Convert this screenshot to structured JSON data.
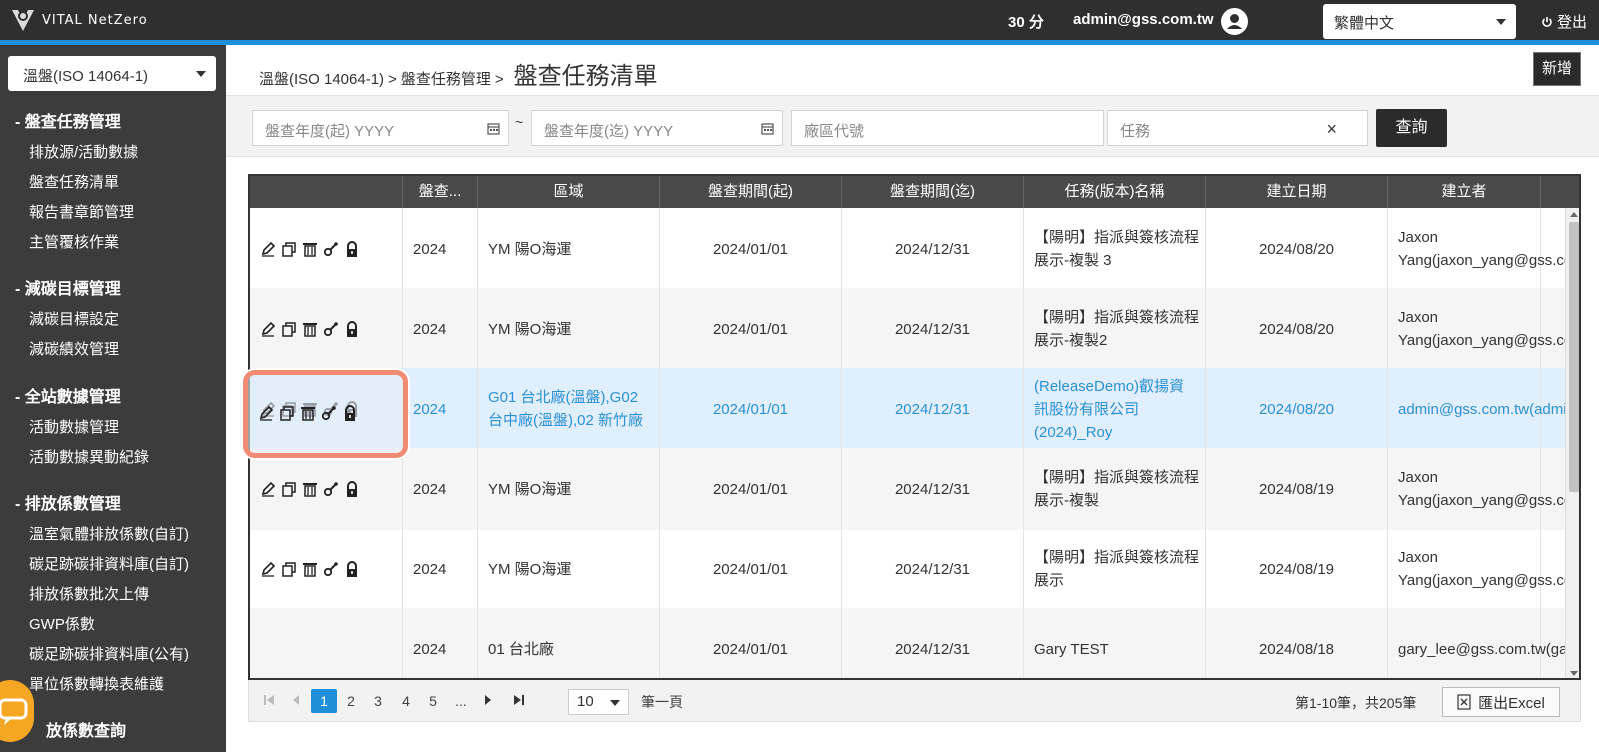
{
  "app": {
    "logo_text": "VITAL NetZero"
  },
  "topbar": {
    "timer": "30 分",
    "user_email": "admin@gss.com.tw",
    "language": "繁體中文",
    "logout_label": "登出"
  },
  "sidebar": {
    "module": "溫盤(ISO 14064-1)",
    "groups": [
      {
        "title": "- 盤查任務管理",
        "items": [
          "排放源/活動數據",
          "盤查任務清單",
          "報告書章節管理",
          "主管覆核作業"
        ]
      },
      {
        "title": "- 減碳目標管理",
        "items": [
          "減碳目標設定",
          "減碳績效管理"
        ]
      },
      {
        "title": "- 全站數據管理",
        "items": [
          "活動數據管理",
          "活動數據異動紀錄"
        ]
      },
      {
        "title": "- 排放係數管理",
        "items": [
          "溫室氣體排放係數(自訂)",
          "碳足跡碳排資料庫(自訂)",
          "排放係數批次上傳",
          "GWP係數",
          "碳足跡碳排資料庫(公有)",
          "單位係數轉換表維護"
        ]
      },
      {
        "title": "放係數查詢",
        "items": []
      }
    ]
  },
  "header": {
    "crumbs": [
      "溫盤(ISO 14064-1)",
      "盤查任務管理"
    ],
    "separator": ">",
    "title": "盤查任務清單",
    "add_label": "新增"
  },
  "filters": {
    "year_from_placeholder": "盤查年度(起) YYYY",
    "tilde": "~",
    "year_to_placeholder": "盤查年度(迄) YYYY",
    "site_placeholder": "廠區代號",
    "task_placeholder": "任務",
    "clear": "×",
    "query_label": "查詢"
  },
  "table": {
    "columns": [
      "",
      "盤查...",
      "區域",
      "盤查期間(起)",
      "盤查期間(迄)",
      "任務(版本)名稱",
      "建立日期",
      "建立者"
    ],
    "rows": [
      {
        "year": "2024",
        "region": "YM 陽O海運",
        "start": "2024/01/01",
        "end": "2024/12/31",
        "task": "【陽明】指派與簽核流程展示-複製 3",
        "created": "2024/08/20",
        "creator": "Jaxon Yang(jaxon_yang@gss.com.tw)",
        "has_actions": true
      },
      {
        "year": "2024",
        "region": "YM 陽O海運",
        "start": "2024/01/01",
        "end": "2024/12/31",
        "task": "【陽明】指派與簽核流程展示-複製2",
        "created": "2024/08/20",
        "creator": "Jaxon Yang(jaxon_yang@gss.com.tw)",
        "has_actions": true
      },
      {
        "year": "2024",
        "region": "G01 台北廠(溫盤),G02 台中廠(溫盤),02 新竹廠",
        "start": "2024/01/01",
        "end": "2024/12/31",
        "task": "(ReleaseDemo)叡揚資訊股份有限公司(2024)_Roy",
        "created": "2024/08/20",
        "creator": "admin@gss.com.tw(admin@gss.com.tw)",
        "has_actions": true
      },
      {
        "year": "2024",
        "region": "YM 陽O海運",
        "start": "2024/01/01",
        "end": "2024/12/31",
        "task": "【陽明】指派與簽核流程展示-複製",
        "created": "2024/08/19",
        "creator": "Jaxon Yang(jaxon_yang@gss.com.tw)",
        "has_actions": true
      },
      {
        "year": "2024",
        "region": "YM 陽O海運",
        "start": "2024/01/01",
        "end": "2024/12/31",
        "task": "【陽明】指派與簽核流程展示",
        "created": "2024/08/19",
        "creator": "Jaxon Yang(jaxon_yang@gss.com.tw)",
        "has_actions": true
      },
      {
        "year": "2024",
        "region": "01 台北廠",
        "start": "2024/01/01",
        "end": "2024/12/31",
        "task": "Gary TEST",
        "created": "2024/08/18",
        "creator": "gary_lee@gss.com.tw(gary_lee@gss.com.tw)",
        "has_actions": false
      }
    ]
  },
  "pager": {
    "pages": [
      "1",
      "2",
      "3",
      "4",
      "5",
      "..."
    ],
    "current_page": "1",
    "page_size": "10",
    "per_page_label": "筆一頁",
    "record_info": "第1-10筆，共205筆",
    "export_label": "匯出Excel"
  },
  "colors": {
    "accent": "#1e8fd8",
    "topbar": "#2f2f2f",
    "sidebar": "#3c3c3c",
    "highlight": "#f28b74",
    "selected_row": "#e0effd"
  }
}
